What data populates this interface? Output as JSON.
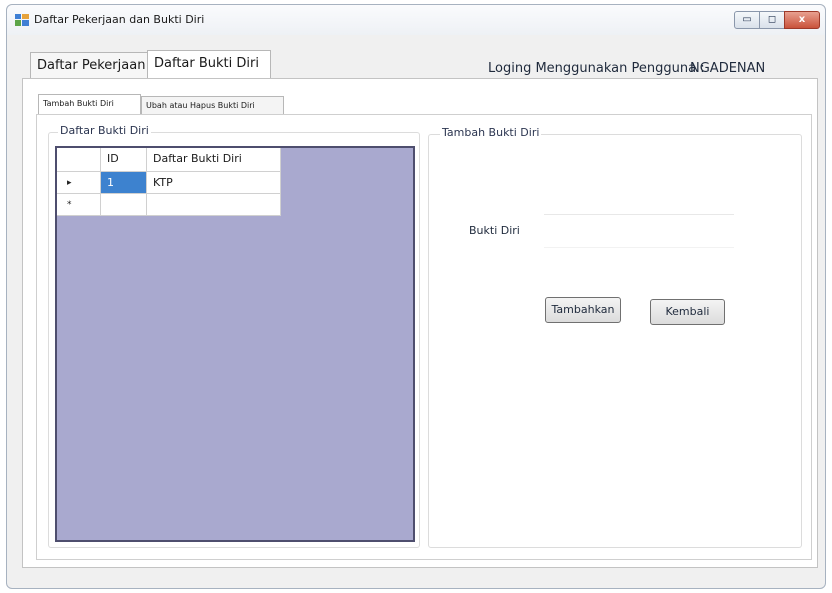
{
  "window": {
    "title": "Daftar Pekerjaan dan Bukti Diri",
    "minimize_glyph": "▭",
    "maximize_glyph": "◻",
    "close_glyph": "x"
  },
  "main_tabs": [
    "Daftar Pekerjaan",
    "Daftar Bukti Diri"
  ],
  "login": {
    "label": "Loging Menggunakan Pengguna :",
    "user": "NGADENAN"
  },
  "sub_tabs": [
    "Tambah Bukti Diri",
    "Ubah atau Hapus Bukti Diri"
  ],
  "list_group": {
    "caption": "Daftar Bukti Diri",
    "columns": [
      "ID",
      "Daftar Bukti Diri"
    ],
    "rows": [
      {
        "marker": "▸",
        "id": "1",
        "name": "KTP"
      },
      {
        "marker": "*",
        "id": "",
        "name": ""
      }
    ]
  },
  "form_group": {
    "caption": "Tambah Bukti Diri",
    "field_label": "Bukti Diri",
    "field_value": "",
    "add_button": "Tambahkan",
    "back_button": "Kembali"
  }
}
